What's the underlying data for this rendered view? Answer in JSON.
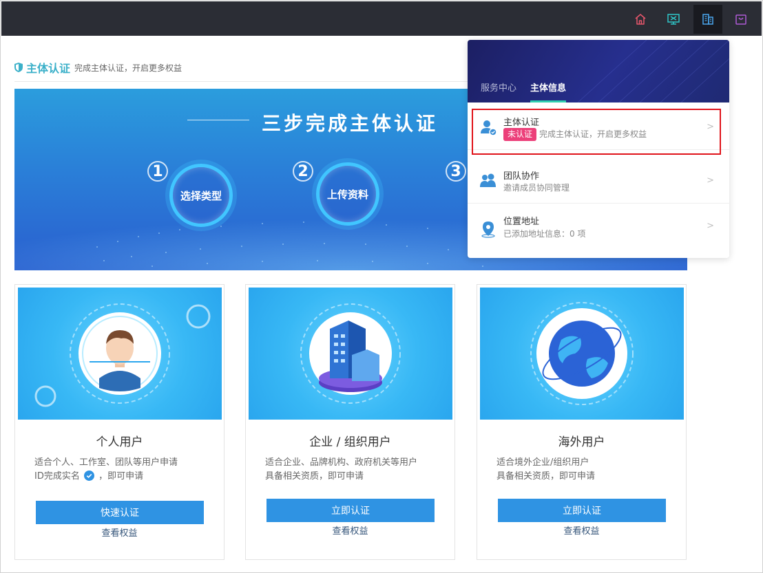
{
  "topbar": {
    "icons": [
      "home-icon",
      "monitor-icon",
      "building-icon",
      "bag-icon"
    ],
    "active": "building-icon"
  },
  "header": {
    "title": "主体认证",
    "subtitle": "完成主体认证，开启更多权益"
  },
  "banner": {
    "title": "三步完成主体认证",
    "steps": [
      {
        "num": "1",
        "label": "选择类型"
      },
      {
        "num": "2",
        "label": "上传资料"
      },
      {
        "num": "3",
        "label": ""
      }
    ]
  },
  "cards": [
    {
      "title": "个人用户",
      "desc_line1": "适合个人、工作室、团队等用户申请",
      "desc_line2a": "ID完成实名",
      "desc_line2b": "，即可申请",
      "button": "快速认证",
      "link": "查看权益"
    },
    {
      "title": "企业 / 组织用户",
      "desc_line1": "适合企业、品牌机构、政府机关等用户",
      "desc_line2a": "具备相关资质，即可申请",
      "button": "立即认证",
      "link": "查看权益"
    },
    {
      "title": "海外用户",
      "desc_line1": "适合境外企业/组织用户",
      "desc_line2a": "具备相关资质，即可申请",
      "button": "立即认证",
      "link": "查看权益"
    }
  ],
  "panel": {
    "tabs": [
      "服务中心",
      "主体信息"
    ],
    "active_tab": "主体信息",
    "rows": [
      {
        "title": "主体认证",
        "badge": "未认证",
        "sub": "完成主体认证，开启更多权益",
        "icon": "user-verify-icon"
      },
      {
        "title": "团队协作",
        "sub": "邀请成员协同管理",
        "icon": "team-icon"
      },
      {
        "title": "位置地址",
        "sub": "已添加地址信息：0 项",
        "icon": "location-icon"
      }
    ],
    "arrow": ">"
  },
  "colors": {
    "accent": "#2f93e3",
    "header_title": "#3bb0c9",
    "badge": "#ec407a",
    "topbar": "#2b2d35",
    "highlight_border": "#e0131a"
  }
}
